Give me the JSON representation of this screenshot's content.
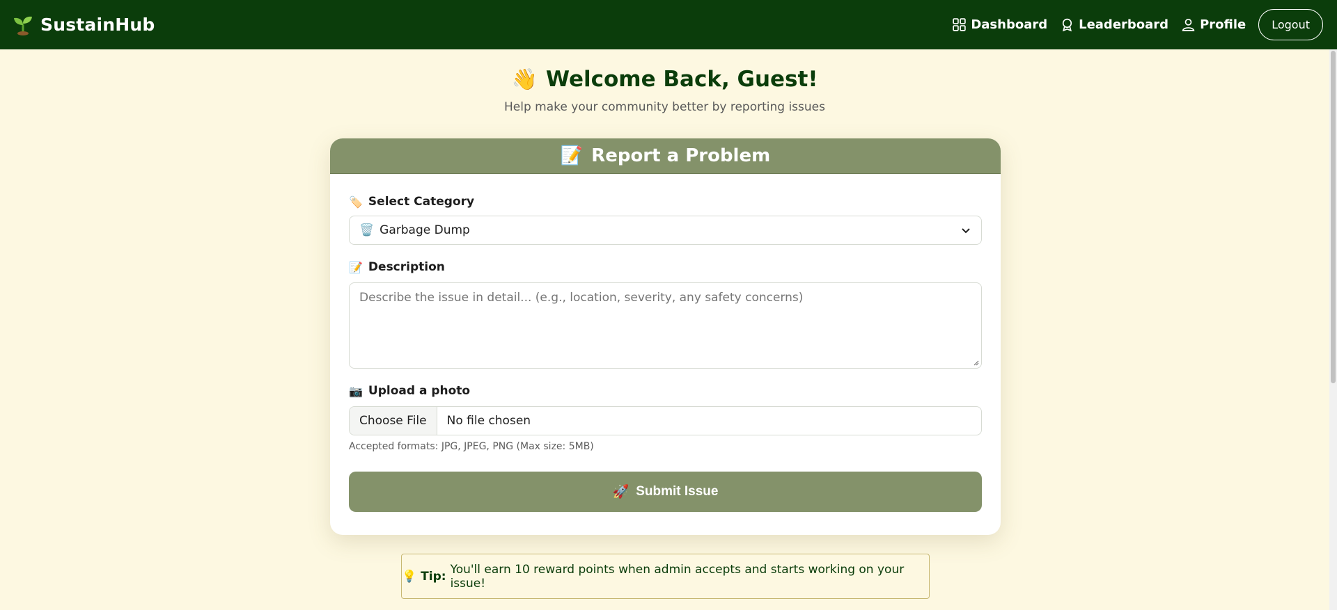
{
  "navbar": {
    "brand": "SustainHub",
    "links": [
      "Dashboard",
      "Leaderboard",
      "Profile"
    ],
    "logout_label": "Logout"
  },
  "welcome": {
    "emoji": "👋",
    "title": "Welcome Back, Guest!",
    "subtitle": "Help make your community better by reporting issues"
  },
  "form": {
    "header_emoji": "📝",
    "header": "Report a Problem",
    "category": {
      "emoji": "🏷️",
      "label": "Select Category",
      "selected_emoji": "🗑️",
      "selected": "Garbage Dump"
    },
    "description": {
      "emoji": "📝",
      "label": "Description",
      "placeholder": "Describe the issue in detail... (e.g., location, severity, any safety concerns)"
    },
    "photo": {
      "emoji": "📷",
      "label": "Upload a photo",
      "button": "Choose File",
      "file_status": "No file chosen",
      "hint": "Accepted formats: JPG, JPEG, PNG (Max size: 5MB)"
    },
    "submit_emoji": "🚀",
    "submit": "Submit Issue"
  },
  "tip": {
    "emoji": "💡",
    "prefix": "Tip:",
    "text": "You'll earn 10 reward points when admin accepts and starts working on your issue!"
  },
  "colors": {
    "nav_bg": "#0b3d0b",
    "page_bg": "#fdf8e1",
    "accent": "#84926a"
  }
}
